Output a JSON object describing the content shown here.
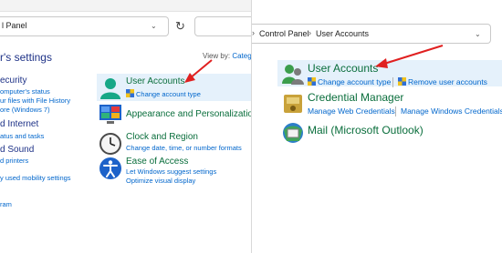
{
  "left": {
    "address": "l Panel",
    "heading": "r's settings",
    "view_by_label": "View by:",
    "view_by_value": "Categ",
    "cut_sections": [
      {
        "title": "ecurity",
        "links": [
          "omputer's status",
          "ur files with File History",
          "ore (Windows 7)"
        ]
      },
      {
        "title": "d Internet",
        "links": [
          "atus and tasks"
        ]
      },
      {
        "title": "d Sound",
        "links": [
          "d printers",
          "y used mobility settings"
        ]
      },
      {
        "title": "",
        "links": [
          "ram"
        ]
      }
    ],
    "items": [
      {
        "title": "User Accounts",
        "links": [
          "Change account type"
        ]
      },
      {
        "title": "Appearance and Personalization",
        "links": []
      },
      {
        "title": "Clock and Region",
        "links": [
          "Change date, time, or number formats"
        ]
      },
      {
        "title": "Ease of Access",
        "links": [
          "Let Windows suggest settings",
          "Optimize visual display"
        ]
      }
    ]
  },
  "right": {
    "breadcrumb": [
      "Control Panel",
      "User Accounts"
    ],
    "items": [
      {
        "title": "User Accounts",
        "links": [
          "Change account type",
          "Remove user accounts"
        ]
      },
      {
        "title": "Credential Manager",
        "links": [
          "Manage Web Credentials",
          "Manage Windows Credentials"
        ]
      },
      {
        "title": "Mail (Microsoft Outlook)",
        "links": []
      }
    ]
  },
  "colors": {
    "accent_title": "#0a6e3c",
    "link": "#0066cc",
    "arrow": "#e02020",
    "highlight": "#e5f1fb"
  }
}
